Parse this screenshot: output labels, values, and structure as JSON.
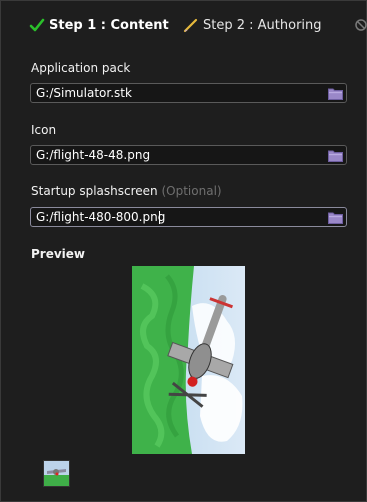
{
  "steps": [
    {
      "label": "Step 1 : Content",
      "state": "active",
      "icon": "checkmark-icon"
    },
    {
      "label": "Step 2 : Authoring",
      "state": "pending",
      "icon": "pencil-icon"
    }
  ],
  "fields": {
    "app_pack": {
      "label": "Application pack",
      "value": "G:/Simulator.stk",
      "button_icon": "folder-icon"
    },
    "icon": {
      "label": "Icon",
      "value": "G:/flight-48-48.png",
      "button_icon": "folder-icon"
    },
    "splash": {
      "label": "Startup splashscreen",
      "optional_note": "(Optional)",
      "value": "G:/flight-480-800.png",
      "button_icon": "folder-icon"
    }
  },
  "preview": {
    "label": "Preview"
  },
  "colors": {
    "accent_check": "#2bc02b",
    "folder": "#9a88c8",
    "pencil": "#e6b93c"
  }
}
